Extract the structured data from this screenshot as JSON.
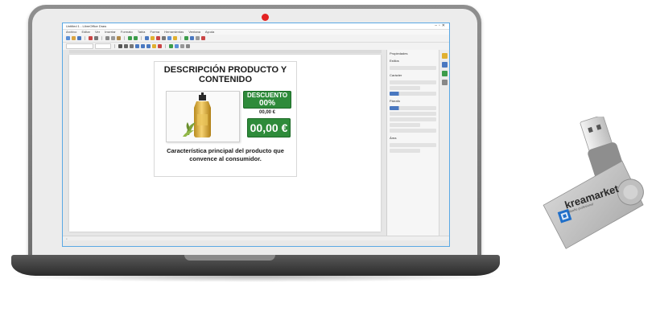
{
  "app": {
    "title_bar": "Untitled 1 - LibreOffice Draw",
    "menu": [
      "Archivo",
      "Editar",
      "Ver",
      "Insertar",
      "Formato",
      "Tabla",
      "Forma",
      "Herramientas",
      "Ventana",
      "Ayuda"
    ]
  },
  "label": {
    "title": "DESCRIPCIÓN PRODUCTO Y CONTENIDO",
    "discount_line1": "DESCUENTO",
    "discount_line2": "00%",
    "old_price": "00,00 €",
    "price": "00,00 €",
    "description": "Característica principal del producto que convence al consumidor."
  },
  "sidebar": {
    "title": "Propiedades",
    "sections": [
      "Estilos",
      "Carácter",
      "Párrafo",
      "Área"
    ]
  },
  "usb": {
    "brand": "kreamarket",
    "subtitle": "diseño profesional"
  },
  "colors": {
    "accent_green": "#2e8b3a",
    "camera_red": "#e32222",
    "usb_blue": "#1f6fc9"
  }
}
